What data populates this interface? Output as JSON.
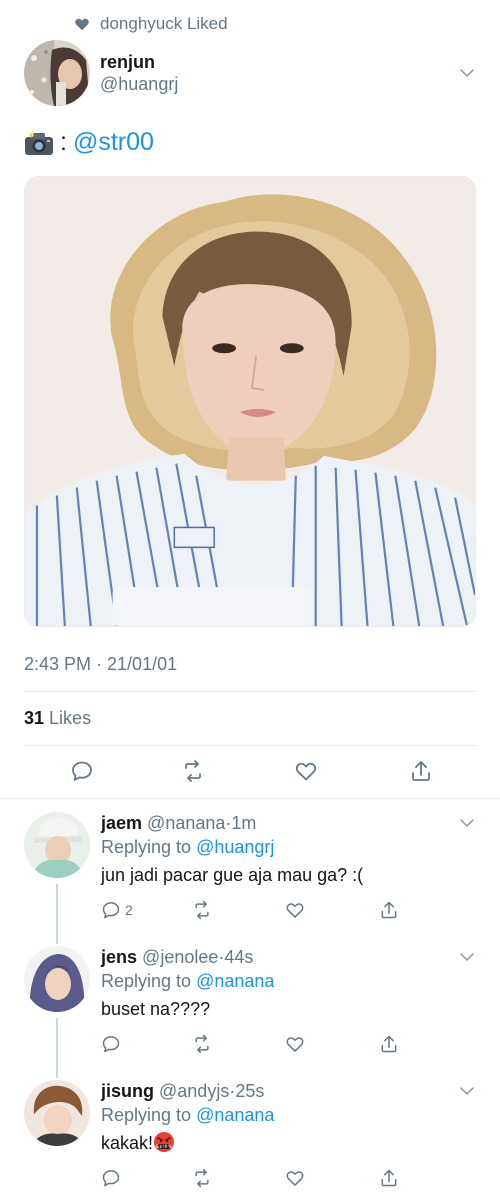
{
  "social_context": {
    "text": "donghyuck Liked"
  },
  "tweet": {
    "author_name": "renjun",
    "author_handle": "@huangrj",
    "text_separator": ":",
    "text_mention": "@str00",
    "timestamp": "2:43 PM · 21/01/01",
    "likes_count": "31",
    "likes_label": "Likes"
  },
  "replies": [
    {
      "name": "jaem",
      "handle": "@nanana",
      "separator": "·",
      "time": "1m",
      "replying_prefix": "Replying to",
      "replying_to": "@huangrj",
      "text": "jun jadi pacar gue aja mau ga? :(",
      "reply_count": "2"
    },
    {
      "name": "jens",
      "handle": "@jenolee",
      "separator": "·",
      "time": "44s",
      "replying_prefix": "Replying to",
      "replying_to": "@nanana",
      "text": "buset na????",
      "reply_count": ""
    },
    {
      "name": "jisung",
      "handle": "@andyjs",
      "separator": "·",
      "time": "25s",
      "replying_prefix": "Replying to",
      "replying_to": "@nanana",
      "text": "kakak!",
      "reply_count": ""
    }
  ],
  "colors": {
    "accent": "#1b95e0",
    "secondary_text": "#657786",
    "divider": "#e6ecf0"
  },
  "icons": {
    "social": "heart-icon",
    "menu": "chevron-down-icon",
    "reply": "reply-icon",
    "retweet": "retweet-icon",
    "like": "like-icon",
    "share": "share-icon",
    "camera": "camera-flash-emoji",
    "angry": "angry-cursing-emoji"
  }
}
